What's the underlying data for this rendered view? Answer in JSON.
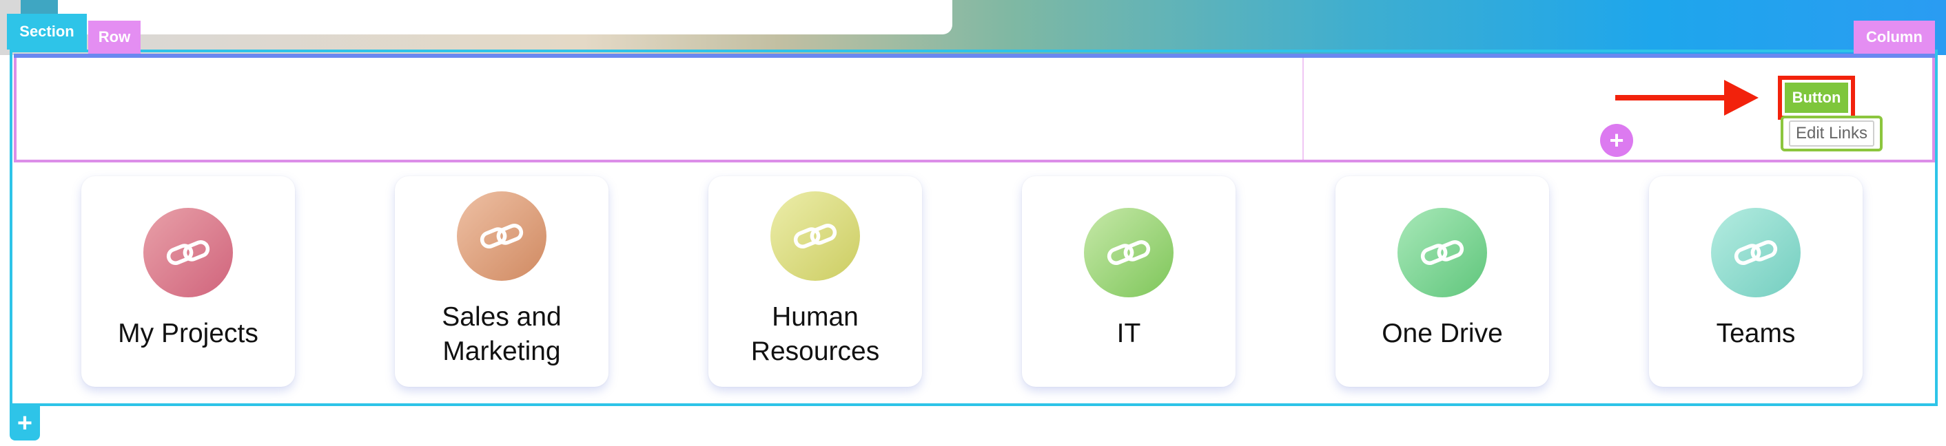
{
  "editor": {
    "section_label": "Section",
    "row_label": "Row",
    "column_label": "Column",
    "button_label": "Button",
    "edit_links_label": "Edit Links",
    "add_row_symbol": "+",
    "add_section_symbol": "+",
    "arrow_color": "#f2220c",
    "section_color": "#2ec4e8",
    "row_color": "#e48ef2"
  },
  "links": [
    {
      "title": "My Projects",
      "icon": "link-icon",
      "gradient": [
        "#e8a0a8",
        "#d0647c"
      ]
    },
    {
      "title": "Sales and Marketing",
      "icon": "link-icon",
      "gradient": [
        "#eec0a4",
        "#d08a62"
      ]
    },
    {
      "title": "Human Resources",
      "icon": "link-icon",
      "gradient": [
        "#ecedaa",
        "#cccd62"
      ]
    },
    {
      "title": "IT",
      "icon": "link-icon",
      "gradient": [
        "#c6e8a8",
        "#7ec65a"
      ]
    },
    {
      "title": "One Drive",
      "icon": "link-icon",
      "gradient": [
        "#a8e8b8",
        "#60c67c"
      ]
    },
    {
      "title": "Teams",
      "icon": "link-icon",
      "gradient": [
        "#b4ece0",
        "#74cec0"
      ]
    }
  ]
}
